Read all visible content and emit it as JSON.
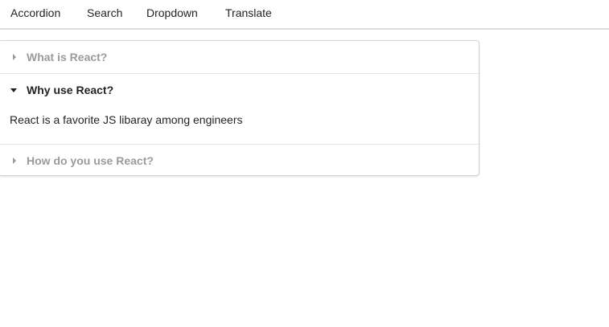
{
  "menu": {
    "items": [
      {
        "label": "Accordion"
      },
      {
        "label": "Search"
      },
      {
        "label": "Dropdown"
      },
      {
        "label": "Translate"
      }
    ]
  },
  "accordion": {
    "items": [
      {
        "title": "What is React?",
        "expanded": false
      },
      {
        "title": "Why use React?",
        "expanded": true,
        "content": "React is a favorite JS libaray among engineers"
      },
      {
        "title": "How do you use React?",
        "expanded": false
      }
    ]
  },
  "icons": {
    "collapsed": "caret-right-icon",
    "expanded": "caret-down-icon"
  },
  "colors": {
    "inactive_title": "#999999",
    "active_title": "#212121",
    "border": "#d4d4d5"
  }
}
